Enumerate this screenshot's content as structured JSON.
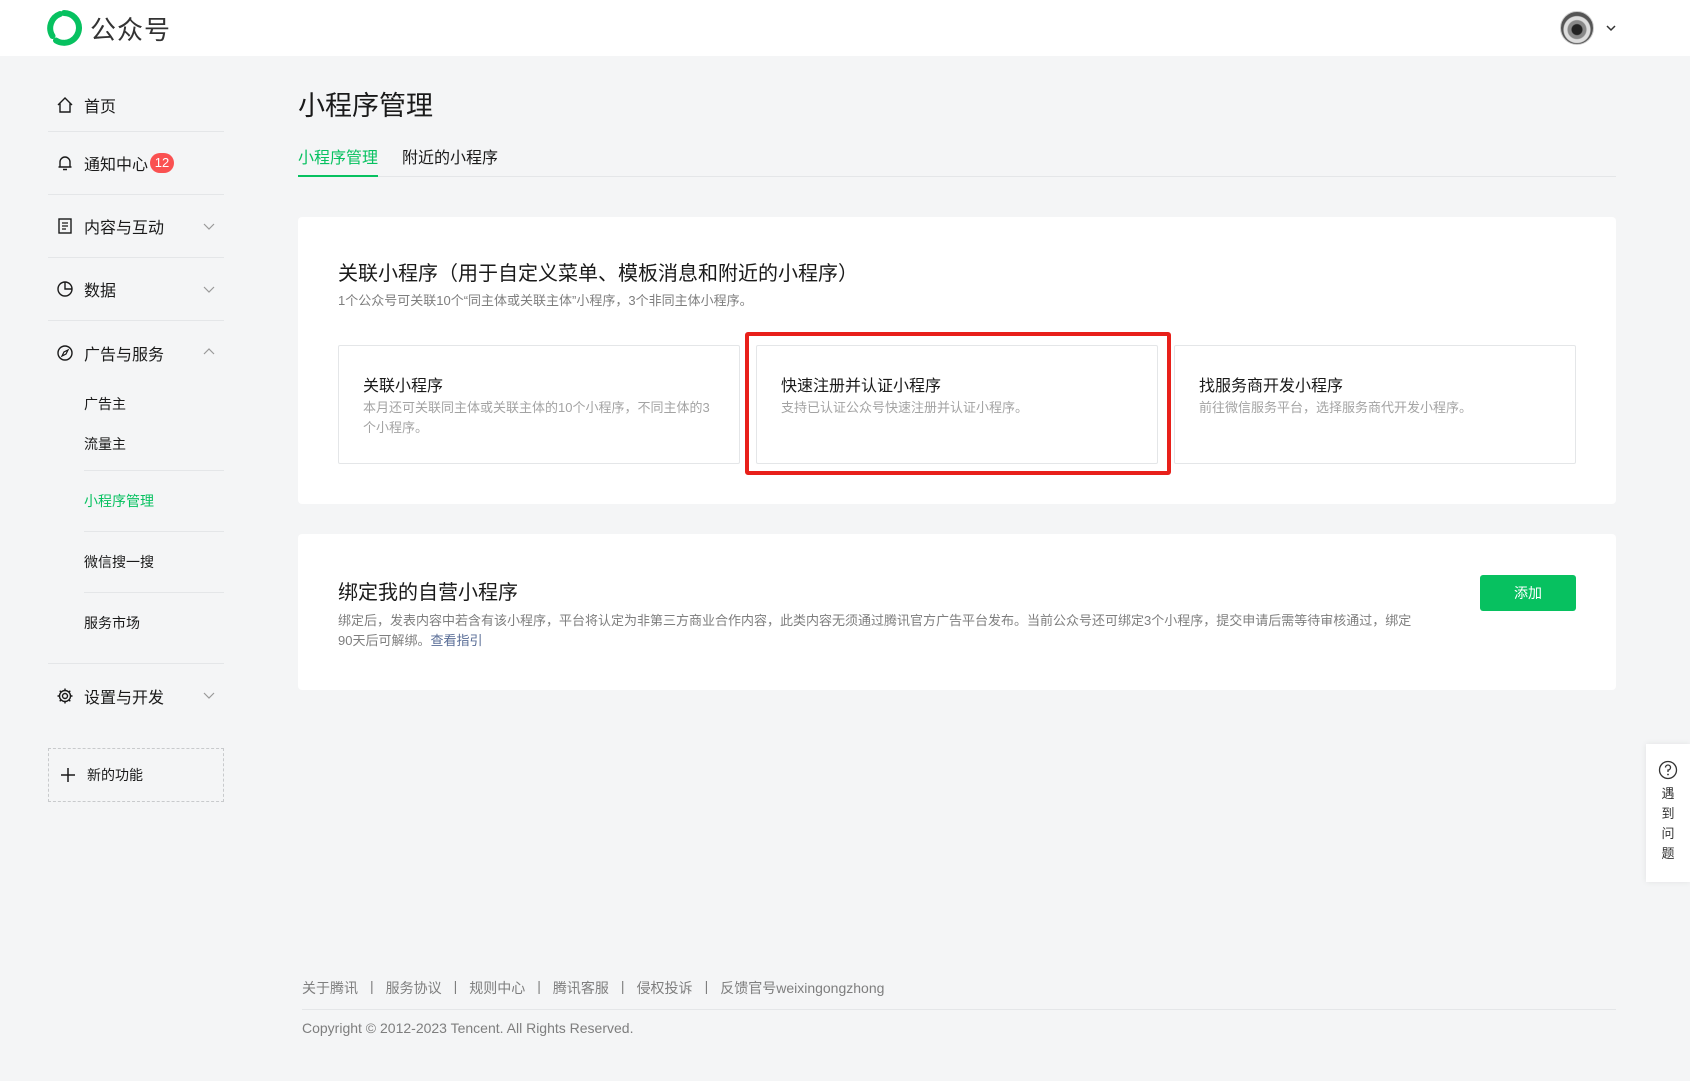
{
  "header": {
    "app_name": "公众号",
    "brand_color": "#07c160",
    "logo_icon": "wechat-official-account-logo",
    "avatar_icon": "user-avatar",
    "menu_icon": "chevron-down-icon"
  },
  "sidebar": {
    "items": [
      {
        "label": "首页",
        "icon": "home-icon"
      },
      {
        "label": "通知中心",
        "icon": "bell-icon",
        "badge": "12"
      },
      {
        "label": "内容与互动",
        "icon": "document-icon"
      },
      {
        "label": "数据",
        "icon": "pie-chart-icon"
      },
      {
        "label": "广告与服务",
        "icon": "compass-icon"
      },
      {
        "label": "设置与开发",
        "icon": "gear-icon"
      }
    ],
    "sub_items": [
      {
        "label": "广告主"
      },
      {
        "label": "流量主"
      },
      {
        "label": "小程序管理",
        "active": true
      },
      {
        "label": "微信搜一搜"
      },
      {
        "label": "服务市场"
      }
    ],
    "new_feature": "新的功能"
  },
  "main": {
    "title": "小程序管理",
    "tabs": [
      {
        "label": "小程序管理",
        "active": true
      },
      {
        "label": "附近的小程序"
      }
    ],
    "link_section": {
      "title": "关联小程序（用于自定义菜单、模板消息和附近的小程序）",
      "desc": "1个公众号可关联10个“同主体或关联主体”小程序，3个非同主体小程序。",
      "options": [
        {
          "title": "关联小程序",
          "desc": "本月还可关联同主体或关联主体的10个小程序，不同主体的3个小程序。"
        },
        {
          "title": "快速注册并认证小程序",
          "desc": "支持已认证公众号快速注册并认证小程序。"
        },
        {
          "title": "找服务商开发小程序",
          "desc": "前往微信服务平台，选择服务商代开发小程序。"
        }
      ]
    },
    "bind_section": {
      "title": "绑定我的自营小程序",
      "desc": "绑定后，发表内容中若含有该小程序，平台将认定为非第三方商业合作内容，此类内容无须通过腾讯官方广告平台发布。当前公众号还可绑定3个小程序，提交申请后需等待审核通过，绑定90天后可解绑。",
      "link": "查看指引",
      "add_button": "添加"
    }
  },
  "help": {
    "label": "遇到问题",
    "icon": "question-circle-icon"
  },
  "footer": {
    "links": [
      "关于腾讯",
      "服务协议",
      "规则中心",
      "腾讯客服",
      "侵权投诉",
      "反馈官号weixingongzhong"
    ],
    "separator": "|",
    "copyright": "Copyright © 2012-2023 Tencent. All Rights Reserved."
  },
  "highlight_color": "#e8201a"
}
